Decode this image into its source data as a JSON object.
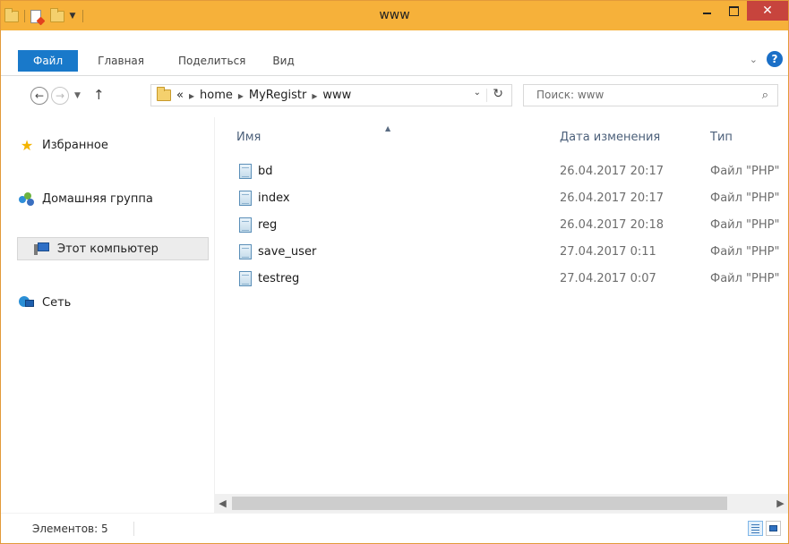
{
  "window": {
    "title": "www"
  },
  "title_buttons": {
    "minimize": "_",
    "maximize": "□",
    "close": "✕"
  },
  "ribbon": {
    "tabs": [
      "Файл",
      "Главная",
      "Поделиться",
      "Вид"
    ]
  },
  "address": {
    "overflow": "«",
    "crumbs": [
      "home",
      "MyRegistr",
      "www"
    ]
  },
  "search": {
    "placeholder": "Поиск: www"
  },
  "nav_pane": {
    "items": [
      {
        "label": "Избранное",
        "icon": "star-icon"
      },
      {
        "label": "Домашняя группа",
        "icon": "homegroup-icon"
      },
      {
        "label": "Этот компьютер",
        "icon": "computer-icon",
        "selected": true
      },
      {
        "label": "Сеть",
        "icon": "network-icon"
      }
    ]
  },
  "columns": {
    "name": "Имя",
    "date": "Дата изменения",
    "type": "Тип"
  },
  "files": [
    {
      "name": "bd",
      "date": "26.04.2017 20:17",
      "type": "Файл \"PHP\""
    },
    {
      "name": "index",
      "date": "26.04.2017 20:17",
      "type": "Файл \"PHP\""
    },
    {
      "name": "reg",
      "date": "26.04.2017 20:18",
      "type": "Файл \"PHP\""
    },
    {
      "name": "save_user",
      "date": "27.04.2017 0:11",
      "type": "Файл \"PHP\""
    },
    {
      "name": "testreg",
      "date": "27.04.2017 0:07",
      "type": "Файл \"PHP\""
    }
  ],
  "status": {
    "items_count": "Элементов: 5"
  },
  "colors": {
    "titlebar": "#f6b13a",
    "file_tab": "#1979ca",
    "close_button": "#c7443d"
  }
}
